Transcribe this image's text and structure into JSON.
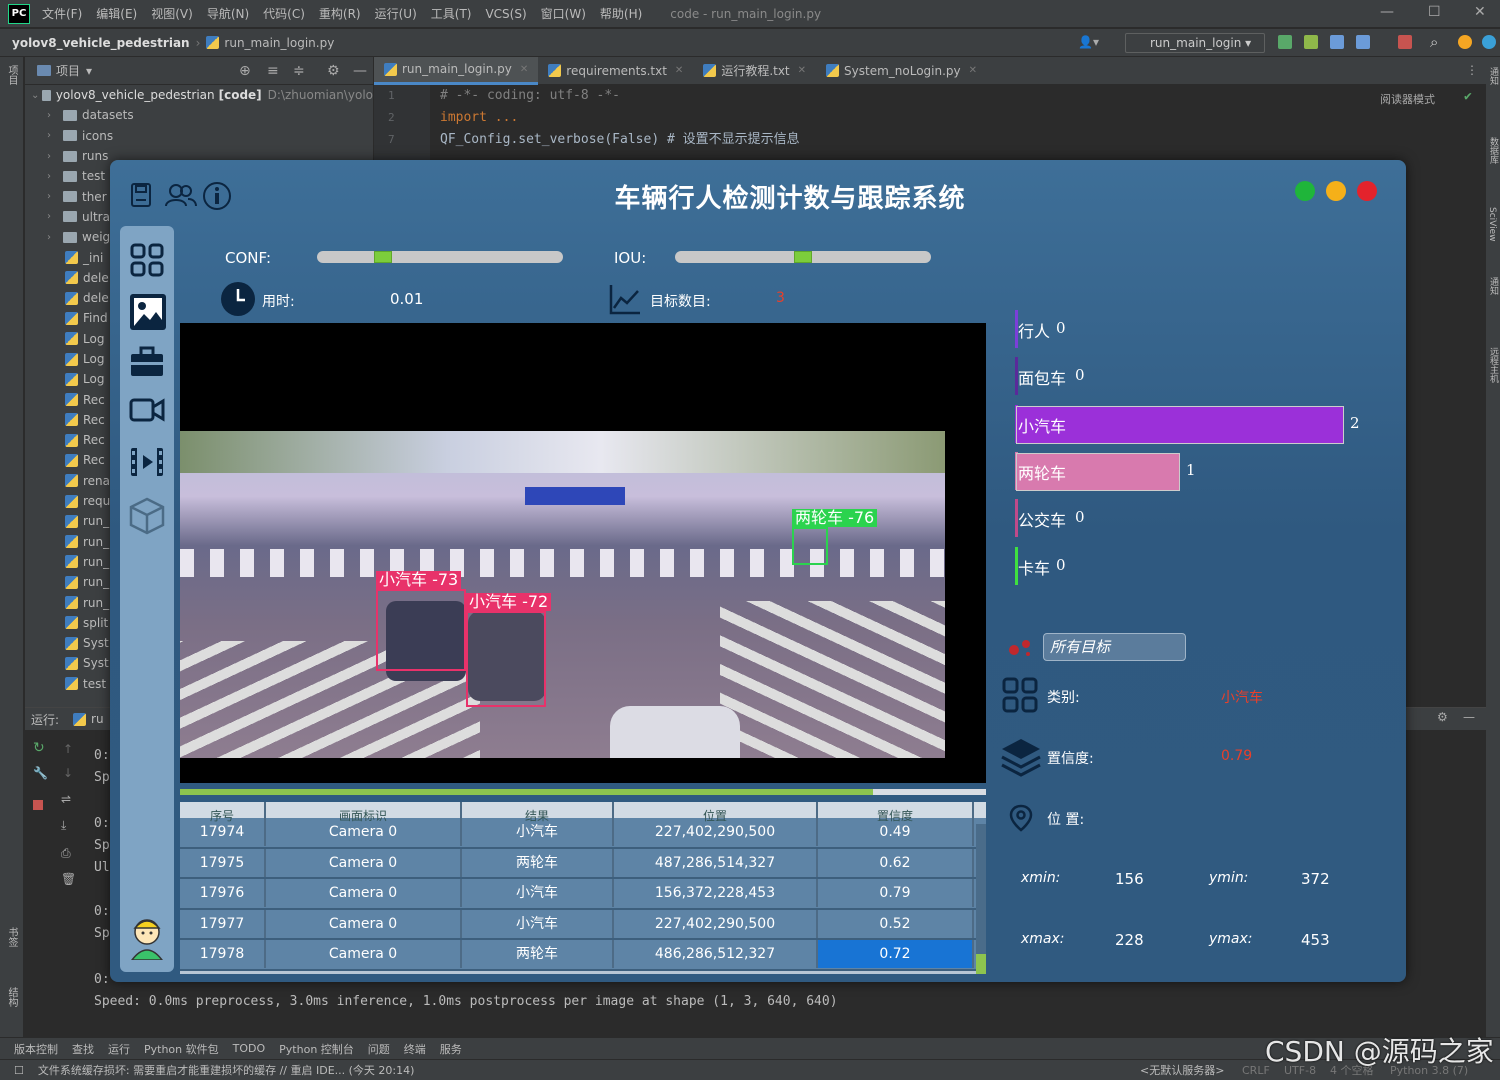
{
  "ide": {
    "menu": [
      "文件(F)",
      "编辑(E)",
      "视图(V)",
      "导航(N)",
      "代码(C)",
      "重构(R)",
      "运行(U)",
      "工具(T)",
      "VCS(S)",
      "窗口(W)",
      "帮助(H)"
    ],
    "window_title": "code - run_main_login.py",
    "nav": {
      "project": "yolov8_vehicle_pedestrian",
      "file": "run_main_login.py",
      "run_config": "run_main_login"
    },
    "left_tool": {
      "project": "项目",
      "bookmarks": "书签",
      "structure": "结构"
    },
    "project_panel": {
      "title": "项目",
      "root_name": "yolov8_vehicle_pedestrian",
      "root_tag": "[code]",
      "root_path": "D:\\zhuomian\\yolo",
      "items": [
        {
          "name": "datasets",
          "type": "folder"
        },
        {
          "name": "icons",
          "type": "folder"
        },
        {
          "name": "runs",
          "type": "folder"
        },
        {
          "name": "test",
          "type": "folder"
        },
        {
          "name": "ther",
          "type": "folder"
        },
        {
          "name": "ultra",
          "type": "folder"
        },
        {
          "name": "weig",
          "type": "folder"
        },
        {
          "name": "_ini",
          "type": "py"
        },
        {
          "name": "dele",
          "type": "py"
        },
        {
          "name": "dele",
          "type": "py"
        },
        {
          "name": "Find",
          "type": "py"
        },
        {
          "name": "Log",
          "type": "py"
        },
        {
          "name": "Log",
          "type": "py"
        },
        {
          "name": "Log",
          "type": "py"
        },
        {
          "name": "Rec",
          "type": "py"
        },
        {
          "name": "Rec",
          "type": "py"
        },
        {
          "name": "Rec",
          "type": "py"
        },
        {
          "name": "Rec",
          "type": "py"
        },
        {
          "name": "rena",
          "type": "py"
        },
        {
          "name": "requ",
          "type": "py"
        },
        {
          "name": "run_",
          "type": "py"
        },
        {
          "name": "run_",
          "type": "py"
        },
        {
          "name": "run_",
          "type": "py"
        },
        {
          "name": "run_",
          "type": "py"
        },
        {
          "name": "run_",
          "type": "py"
        },
        {
          "name": "split",
          "type": "py"
        },
        {
          "name": "Syst",
          "type": "py"
        },
        {
          "name": "Syst",
          "type": "py"
        },
        {
          "name": "test",
          "type": "py"
        }
      ]
    },
    "tabs": [
      {
        "label": "run_main_login.py",
        "active": true
      },
      {
        "label": "requirements.txt",
        "active": false
      },
      {
        "label": "运行教程.txt",
        "active": false
      },
      {
        "label": "System_noLogin.py",
        "active": false
      }
    ],
    "reader_mode": "阅读器模式",
    "line_numbers": [
      "1",
      "2",
      "7"
    ],
    "code_lines": [
      "# -*- coding: utf-8 -*-",
      "import ...",
      "QF_Config.set_verbose(False)  # 设置不显示提示信息"
    ],
    "run_panel": {
      "label": "运行:",
      "tab": "ru",
      "output_lines": [
        "0:",
        "Sp",
        "0:",
        "Sp",
        "Ul",
        "0:",
        "Sp",
        "0:"
      ],
      "speed_line": "Speed: 0.0ms preprocess, 3.0ms inference, 1.0ms postprocess per image at shape (1, 3, 640, 640)"
    },
    "bottom_tabs": [
      "版本控制",
      "查找",
      "运行",
      "Python 软件包",
      "TODO",
      "Python 控制台",
      "问题",
      "终端",
      "服务"
    ],
    "status_message": "文件系统缓存损坏: 需要重启才能重建损坏的缓存 // 重启 IDE... (今天 20:14)",
    "status_right": [
      "<无默认服务器>",
      "CRLF",
      "UTF-8",
      "4 个空格",
      "Python 3.8 (7)"
    ],
    "right_tool": [
      "通知",
      "数据库",
      "SciView",
      "通知",
      "远程主机"
    ]
  },
  "app": {
    "title": "车辆行人检测计数与跟踪系统",
    "window_dots": {
      "green": "#1fb53a",
      "yellow": "#f5b019",
      "red": "#e3232c"
    },
    "conf_label": "CONF:",
    "conf_value": 0.25,
    "iou_label": "IOU:",
    "iou_value": 0.5,
    "time_label": "用时:",
    "time_value": "0.01",
    "target_count_label": "目标数目:",
    "target_count_value": "3",
    "detections": [
      {
        "label": "小汽车 -73",
        "color": "#e8326a"
      },
      {
        "label": "小汽车 -72",
        "color": "#e8326a"
      },
      {
        "label": "两轮车 -76",
        "color": "#2bd34e"
      }
    ],
    "video_progress": 0.86,
    "table": {
      "headers": [
        "序号",
        "画面标识",
        "结果",
        "位置",
        "置信度"
      ],
      "rows": [
        [
          "17974",
          "Camera 0",
          "小汽车",
          "227,402,290,500",
          "0.49"
        ],
        [
          "17975",
          "Camera 0",
          "两轮车",
          "487,286,514,327",
          "0.62"
        ],
        [
          "17976",
          "Camera 0",
          "小汽车",
          "156,372,228,453",
          "0.79"
        ],
        [
          "17977",
          "Camera 0",
          "小汽车",
          "227,402,290,500",
          "0.52"
        ],
        [
          "17978",
          "Camera 0",
          "两轮车",
          "486,286,512,327",
          "0.72"
        ]
      ],
      "selected_row": 4
    },
    "class_counts": [
      {
        "name": "行人",
        "count": "0",
        "color": "#7b3fd9"
      },
      {
        "name": "面包车",
        "count": "0",
        "color": "#5a2a9a"
      },
      {
        "name": "小汽车",
        "count": "2",
        "color": "#9b30d9"
      },
      {
        "name": "两轮车",
        "count": "1",
        "color": "#d87aae"
      },
      {
        "name": "公交车",
        "count": "0",
        "color": "#c04a8a"
      },
      {
        "name": "卡车",
        "count": "0",
        "color": "#3fe03f"
      }
    ],
    "target_select": "所有目标",
    "class_label": "类别:",
    "class_value": "小汽车",
    "conf_detail_label": "置信度:",
    "conf_detail_value": "0.79",
    "position_label": "位 置:",
    "xmin_label": "xmin:",
    "xmin": "156",
    "ymin_label": "ymin:",
    "ymin": "372",
    "xmax_label": "xmax:",
    "xmax": "228",
    "ymax_label": "ymax:",
    "ymax": "453"
  },
  "watermark": "CSDN @源码之家"
}
